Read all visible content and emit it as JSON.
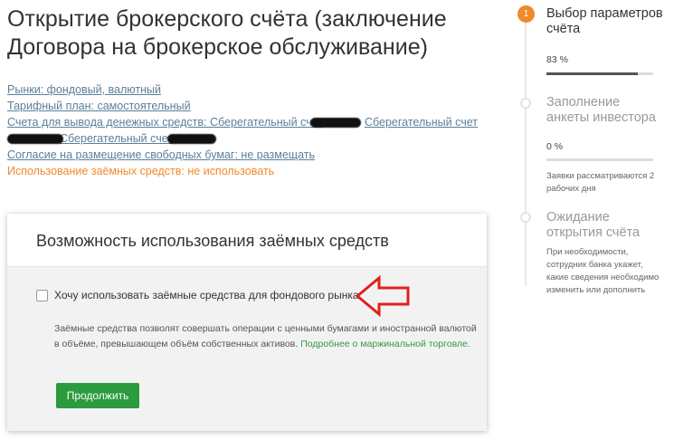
{
  "page": {
    "title": "Открытие брокерского счёта (заключение Договора на брокерское обслуживание)"
  },
  "params": {
    "markets": "Рынки: фондовый, валютный",
    "tariff": "Тарифный план: самостоятельный",
    "accounts_prefix": "Счета для вывода денежных средств: Сберегательный счет",
    "accounts_second": "Сберегательный счет",
    "accounts_third": "Сберегательный счет",
    "lending": "Согласие на размещение свободных бумаг: не размещать",
    "borrowed": "Использование заёмных средств: не использовать"
  },
  "card": {
    "title": "Возможность использования заёмных средств",
    "checkbox_label": "Хочу использовать заёмные средства для фондового рынка",
    "checkbox_checked": false,
    "note_text": "Заёмные средства позволят совершать операции с ценными бумагами и иностранной валютой в объёме, превышающем объём собственных активов.",
    "note_link": "Подробнее о маржинальной торговле.",
    "continue_button": "Продолжить"
  },
  "steps": [
    {
      "number": "1",
      "title": "Выбор параметров счёта",
      "percent": "83 %",
      "progress": 0.86,
      "state": "active"
    },
    {
      "title": "Заполнение анкеты инвестора",
      "percent": "0 %",
      "progress": 0,
      "note": "Заявки рассматриваются 2 рабочих дня",
      "state": "pending"
    },
    {
      "title": "Ожидание открытия счёта",
      "note": "При необходимости, сотрудник банка укажет, какие сведения необходимо изменить или дополнить",
      "state": "pending"
    }
  ],
  "colors": {
    "accent_orange": "#f0892c",
    "button_green": "#2a9b3e",
    "link_blue": "#5b7f9a",
    "annotation_red": "#e02020"
  }
}
